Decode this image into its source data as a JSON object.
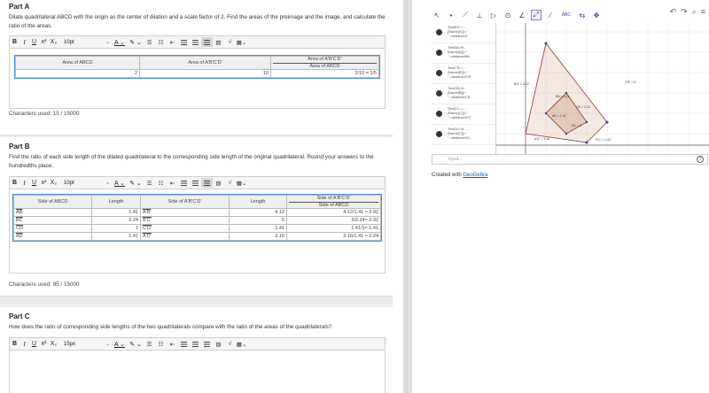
{
  "partA": {
    "title": "Part A",
    "prompt": "Dilate quadrilateral ABCD with the origin as the center of dilation and a scale factor of 2. Find the areas of the preimage and the image, and calculate the ratio of the areas.",
    "fontsize": "10pt",
    "headers": [
      "Area of ABCD",
      "Area of A'B'C'D'",
      "Area of A'B'C'D'",
      "Area of ABCD"
    ],
    "row": [
      "2",
      "10",
      "2/10 = 1/5"
    ],
    "chars": "Characters used: 15 / 15000"
  },
  "partB": {
    "title": "Part B",
    "prompt": "Find the ratio of each side length of the dilated quadrilateral to the corresponding side length of the original quadrilateral. Round your answers to the hundredths place.",
    "fontsize": "10pt",
    "headers": [
      "Side of ABCD",
      "Length",
      "Side of A'B'C'D'",
      "Length",
      "Side of A'B'C'D'",
      "Side of ABCD"
    ],
    "rows": [
      [
        "AB",
        "1.41",
        "A'B'",
        "4.12",
        "4.12/1.41 ≈ 2.92"
      ],
      [
        "BC",
        "2.24",
        "B'C'",
        "5",
        "5/2.24≈ 2.32"
      ],
      [
        "CD",
        "1",
        "C'D'",
        "1.41",
        "1.41/1= 1.41"
      ],
      [
        "AD",
        "1.41",
        "A'D'",
        "3.16",
        "3.16/1.41 ≈ 2.24"
      ]
    ],
    "chars": "Characters used: 95 / 15000"
  },
  "partC": {
    "title": "Part C",
    "prompt": "How does the ratio of corresponding side lengths of the two quadrilaterals compare with the ratio of the areas of the quadrilaterals?",
    "fontsize": "15px"
  },
  "geogebra": {
    "algebra": [
      "TextB'A =...\n[Name[A']]=\"\n\" =distanceA'",
      "TextBA=N...\n[Name[A]]=\"\n\" =distanceBA",
      "TextC'B =...\n[Name[B']]=\"\n\" =distanceC'B'",
      "TextCB=N...\n[Name[B]]=\"\n\" =distanceCB",
      "TextD'C =...\n[Name[C']]=\"\n\" =distanceD'C'",
      "TextDC=N...\n[Name[C]]=\"\n\" =distanceDC"
    ],
    "labels": {
      "BA": "B'A' = 4.12",
      "CB2": "C'B' = 5",
      "ba": "BA = 1.41",
      "cb": "CB = 2.24",
      "ad": "AD = 1.41",
      "dc": "DC = 1",
      "ad2": "A'D' = 3.16",
      "dc2": "D'C' = 1.41"
    },
    "input_placeholder": "Input...",
    "credit_prefix": "Created with ",
    "credit_link": "GeoGebra"
  }
}
